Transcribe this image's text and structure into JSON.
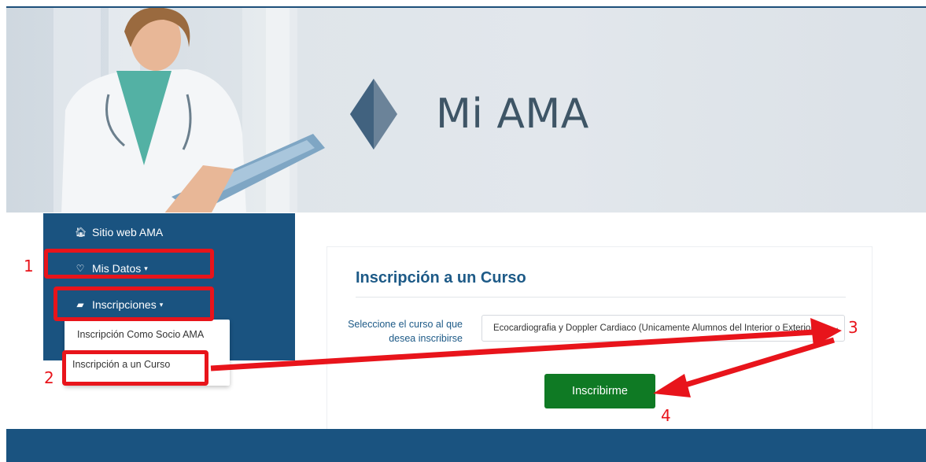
{
  "banner": {
    "brand": "Mi AMA"
  },
  "nav": {
    "items": [
      {
        "label": "Sitio web AMA",
        "icon": "home-icon"
      },
      {
        "label": "Mis Datos",
        "icon": "heart-icon"
      },
      {
        "label": "Inscripciones",
        "icon": "book-icon"
      }
    ],
    "dropdown": [
      {
        "label": "Inscripción Como Socio AMA"
      },
      {
        "label": "Inscripción a un Curso"
      }
    ]
  },
  "form": {
    "title": "Inscripción a un Curso",
    "label": "Seleccione el curso al que desea inscribirse",
    "selected_course": "Ecocardiografia y Doppler Cardiaco (Unicamente Alumnos del Interior o Exterior)",
    "submit_label": "Inscribirme"
  },
  "annotations": {
    "n1": "1",
    "n2": "2",
    "n3": "3",
    "n4": "4",
    "color": "#e8141b"
  },
  "colors": {
    "nav_bg": "#1a5380",
    "title": "#1d5a87",
    "button": "#0f7a24"
  }
}
